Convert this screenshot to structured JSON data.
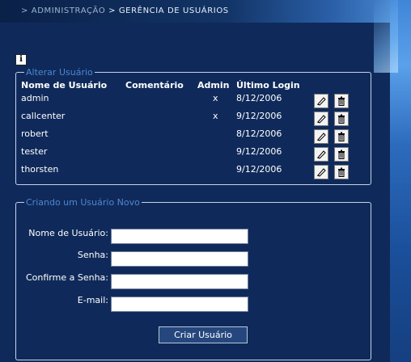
{
  "breadcrumb": {
    "parent": "> ADMINISTRAÇÃO",
    "current": "> GERÊNCIA DE USUÁRIOS"
  },
  "info_icon_glyph": "i",
  "users_panel": {
    "legend": "Alterar Usuário",
    "headers": {
      "name": "Nome de Usuário",
      "comment": "Comentário",
      "admin": "Admin",
      "last_login": "Último Login"
    },
    "rows": [
      {
        "name": "admin",
        "comment": "",
        "admin": "x",
        "last_login": "8/12/2006"
      },
      {
        "name": "callcenter",
        "comment": "",
        "admin": "x",
        "last_login": "9/12/2006"
      },
      {
        "name": "robert",
        "comment": "",
        "admin": "",
        "last_login": "8/12/2006"
      },
      {
        "name": "tester",
        "comment": "",
        "admin": "",
        "last_login": "9/12/2006"
      },
      {
        "name": "thorsten",
        "comment": "",
        "admin": "",
        "last_login": "9/12/2006"
      }
    ]
  },
  "new_user_panel": {
    "legend": "Criando um Usuário Novo",
    "username_label": "Nome de Usuário:",
    "username_value": "",
    "password_label": "Senha:",
    "password_value": "",
    "confirm_label": "Confirme a Senha:",
    "confirm_value": "",
    "email_label": "E-mail:",
    "email_value": "",
    "submit_label": "Criar Usuário"
  },
  "icons": {
    "edit": "pencil-icon",
    "delete": "trash-icon",
    "info": "info-icon"
  },
  "colors": {
    "background": "#0f2a5a",
    "legend": "#4e86d2",
    "accent_edge": "#3f86d8"
  }
}
